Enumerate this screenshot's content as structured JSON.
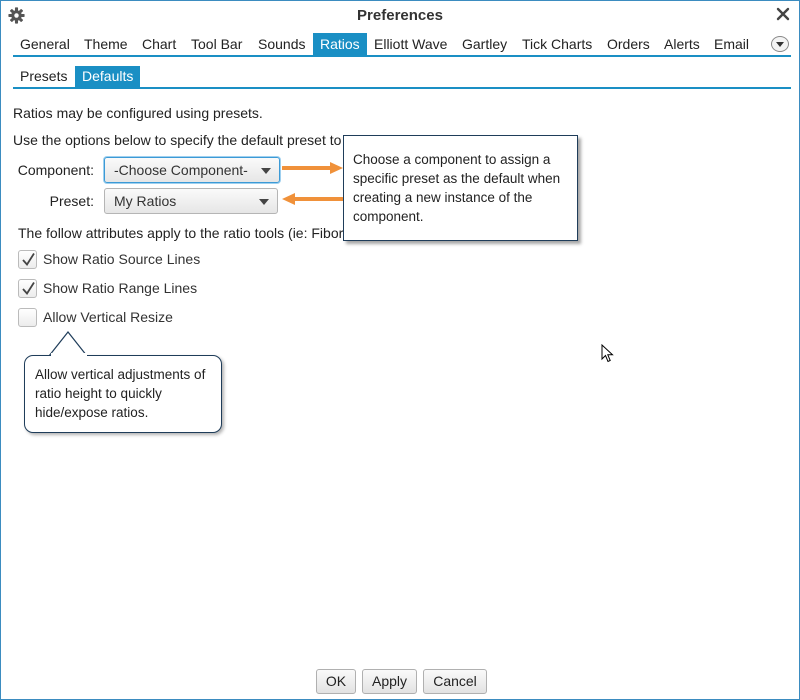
{
  "window": {
    "title": "Preferences",
    "icons": {
      "app": "gear-icon",
      "close": "close-icon"
    }
  },
  "tabs": [
    "General",
    "Theme",
    "Chart",
    "Tool Bar",
    "Sounds",
    "Ratios",
    "Elliott Wave",
    "Gartley",
    "Tick Charts",
    "Orders",
    "Alerts",
    "Email"
  ],
  "active_tab": "Ratios",
  "subtabs": [
    "Presets",
    "Defaults"
  ],
  "active_subtab": "Defaults",
  "content": {
    "intro_line1": "Ratios may be configured using presets.",
    "intro_line2": "Use the options below to specify the default preset to",
    "attributes_line": "The follow attributes apply to the ratio tools (ie: Fibor",
    "component_label": "Component:",
    "component_value": "-Choose Component-",
    "preset_label": "Preset:",
    "preset_value": "My Ratios",
    "checkboxes": [
      {
        "label": "Show Ratio Source Lines",
        "checked": true
      },
      {
        "label": "Show Ratio Range Lines",
        "checked": true
      },
      {
        "label": "Allow Vertical Resize",
        "checked": false
      }
    ]
  },
  "callouts": {
    "component": "Choose a component to assign a specific preset as the default when creating a new instance of the component.",
    "resize": "Allow vertical adjustments of ratio height to quickly hide/expose ratios."
  },
  "buttons": {
    "ok": "OK",
    "apply": "Apply",
    "cancel": "Cancel"
  },
  "colors": {
    "accent": "#1a8fc4",
    "arrow": "#f0913a",
    "callout_border": "#1f3d5a"
  }
}
